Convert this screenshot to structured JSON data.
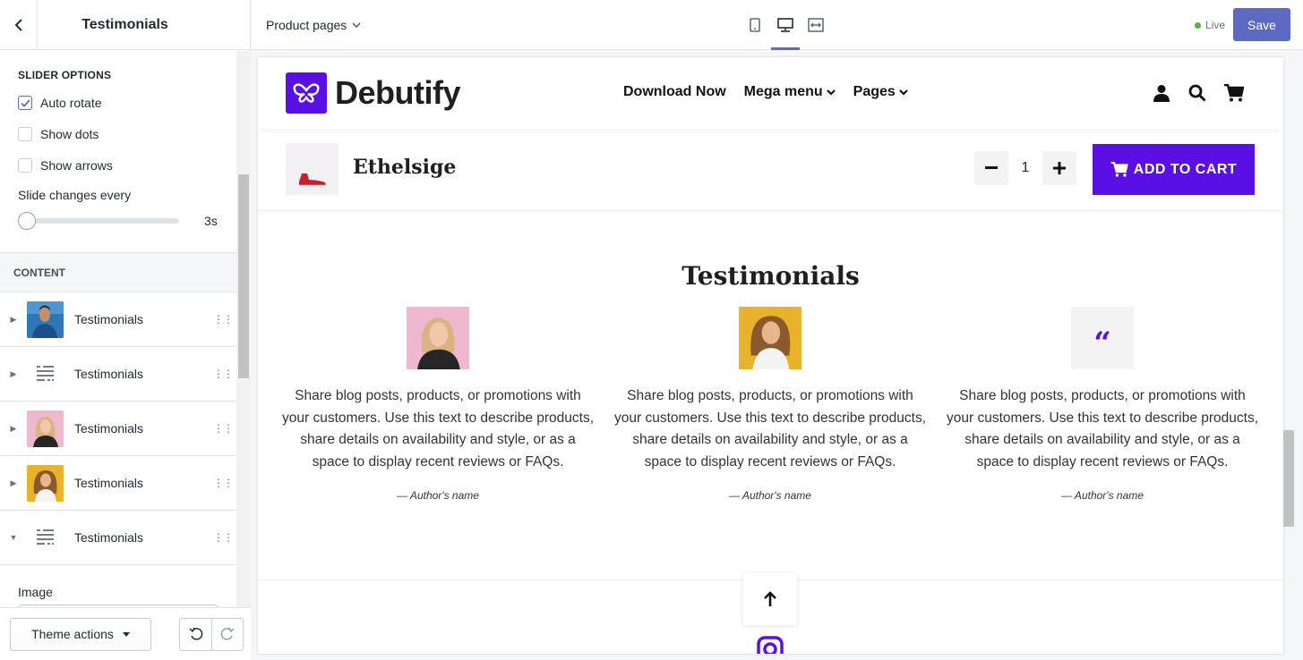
{
  "sidebar": {
    "title": "Testimonials",
    "slider_options": {
      "title": "SLIDER OPTIONS",
      "auto_rotate": {
        "label": "Auto rotate",
        "checked": true
      },
      "show_dots": {
        "label": "Show dots",
        "checked": false
      },
      "show_arrows": {
        "label": "Show arrows",
        "checked": false
      },
      "slide_changes_label": "Slide changes every",
      "slide_changes_value": "3s",
      "slide_changes_level": 0
    },
    "content": {
      "title": "CONTENT",
      "blocks": [
        {
          "label": "Testimonials",
          "thumb": "man-photo",
          "expanded": false
        },
        {
          "label": "Testimonials",
          "thumb": "text-icon",
          "expanded": false
        },
        {
          "label": "Testimonials",
          "thumb": "woman-pink-photo",
          "expanded": false
        },
        {
          "label": "Testimonials",
          "thumb": "woman-yellow-photo",
          "expanded": false
        },
        {
          "label": "Testimonials",
          "thumb": "text-icon",
          "expanded": true
        }
      ]
    },
    "image_label": "Image",
    "footer": {
      "theme_actions": "Theme actions"
    }
  },
  "topbar": {
    "page_select": "Product pages",
    "status": "Live",
    "save": "Save"
  },
  "preview": {
    "brand": "Debutify",
    "nav": [
      "Download Now",
      "Mega menu",
      "Pages"
    ],
    "product": {
      "name": "Ethelsige",
      "quantity": "1",
      "add_to_cart": "ADD TO CART"
    },
    "testimonials": {
      "title": "Testimonials",
      "items": [
        {
          "image": "woman-pink-photo",
          "text": "Share blog posts, products, or promotions with your customers. Use this text to describe products, share details on availability and style, or as a space to display recent reviews or FAQs.",
          "author": "— Author's name"
        },
        {
          "image": "woman-yellow-photo",
          "text": "Share blog posts, products, or promotions with your customers. Use this text to describe products, share details on availability and style, or as a space to display recent reviews or FAQs.",
          "author": "— Author's name"
        },
        {
          "image": "quote-icon",
          "text": "Share blog posts, products, or promotions with your customers. Use this text to describe products, share details on availability and style, or as a space to display recent reviews or FAQs.",
          "author": "— Author's name"
        }
      ]
    }
  },
  "colors": {
    "brand": "#5a10e4",
    "save": "#5c6ac4",
    "live": "#50b83c"
  }
}
